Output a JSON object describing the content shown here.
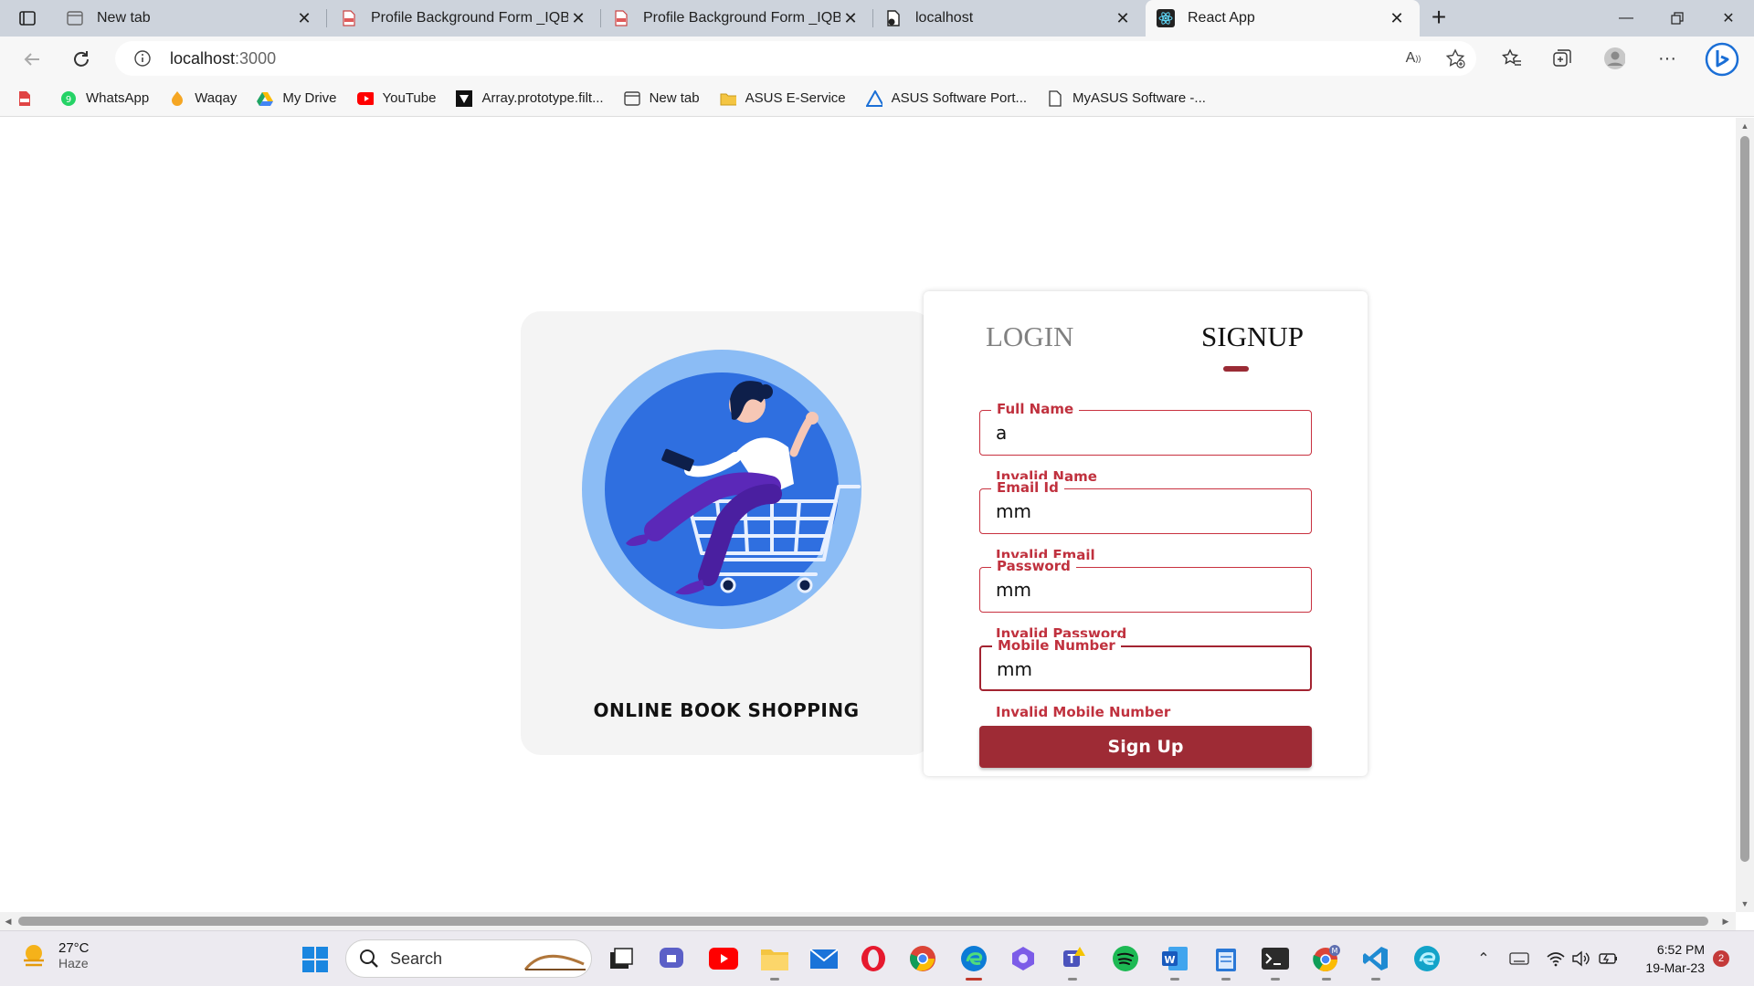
{
  "browser": {
    "tabs": [
      {
        "title": "New tab",
        "icon": "newtab-icon"
      },
      {
        "title": "Profile Background Form _IQBC_",
        "icon": "pdf-icon"
      },
      {
        "title": "Profile Background Form _IQBC_",
        "icon": "pdf-icon"
      },
      {
        "title": "localhost",
        "icon": "blocked-page-icon"
      },
      {
        "title": "React App",
        "icon": "react-icon",
        "active": true
      }
    ],
    "url_host": "localhost",
    "url_rest": ":3000"
  },
  "bookmarks": [
    {
      "label": "",
      "icon": "pdf-icon"
    },
    {
      "label": "WhatsApp",
      "icon": "whatsapp-icon"
    },
    {
      "label": "Waqay",
      "icon": "waqay-icon"
    },
    {
      "label": "My Drive",
      "icon": "drive-icon"
    },
    {
      "label": "YouTube",
      "icon": "youtube-icon"
    },
    {
      "label": "Array.prototype.filt...",
      "icon": "array-icon"
    },
    {
      "label": "New tab",
      "icon": "newtab-icon"
    },
    {
      "label": "ASUS E-Service",
      "icon": "folder-icon"
    },
    {
      "label": "ASUS Software Port...",
      "icon": "asus-icon"
    },
    {
      "label": "MyASUS Software -...",
      "icon": "page-icon"
    }
  ],
  "page": {
    "brand": "ONLINE BOOK SHOPPING",
    "tabs": {
      "login": "LOGIN",
      "signup": "SIGNUP"
    },
    "form": {
      "full_name": {
        "label": "Full Name",
        "value": "a",
        "error": "Invalid Name"
      },
      "email": {
        "label": "Email Id",
        "value": "mm",
        "error": "Invalid Email"
      },
      "password": {
        "label": "Password",
        "value": "mm",
        "error": "Invalid Password"
      },
      "mobile": {
        "label": "Mobile Number",
        "value": "mm",
        "error": "Invalid Mobile Number"
      },
      "submit": "Sign Up"
    },
    "accent": "#9e2b35"
  },
  "taskbar": {
    "weather": {
      "temp": "27°C",
      "desc": "Haze"
    },
    "search": "Search",
    "time": "6:52 PM",
    "date": "19-Mar-23",
    "notifications": "2"
  }
}
